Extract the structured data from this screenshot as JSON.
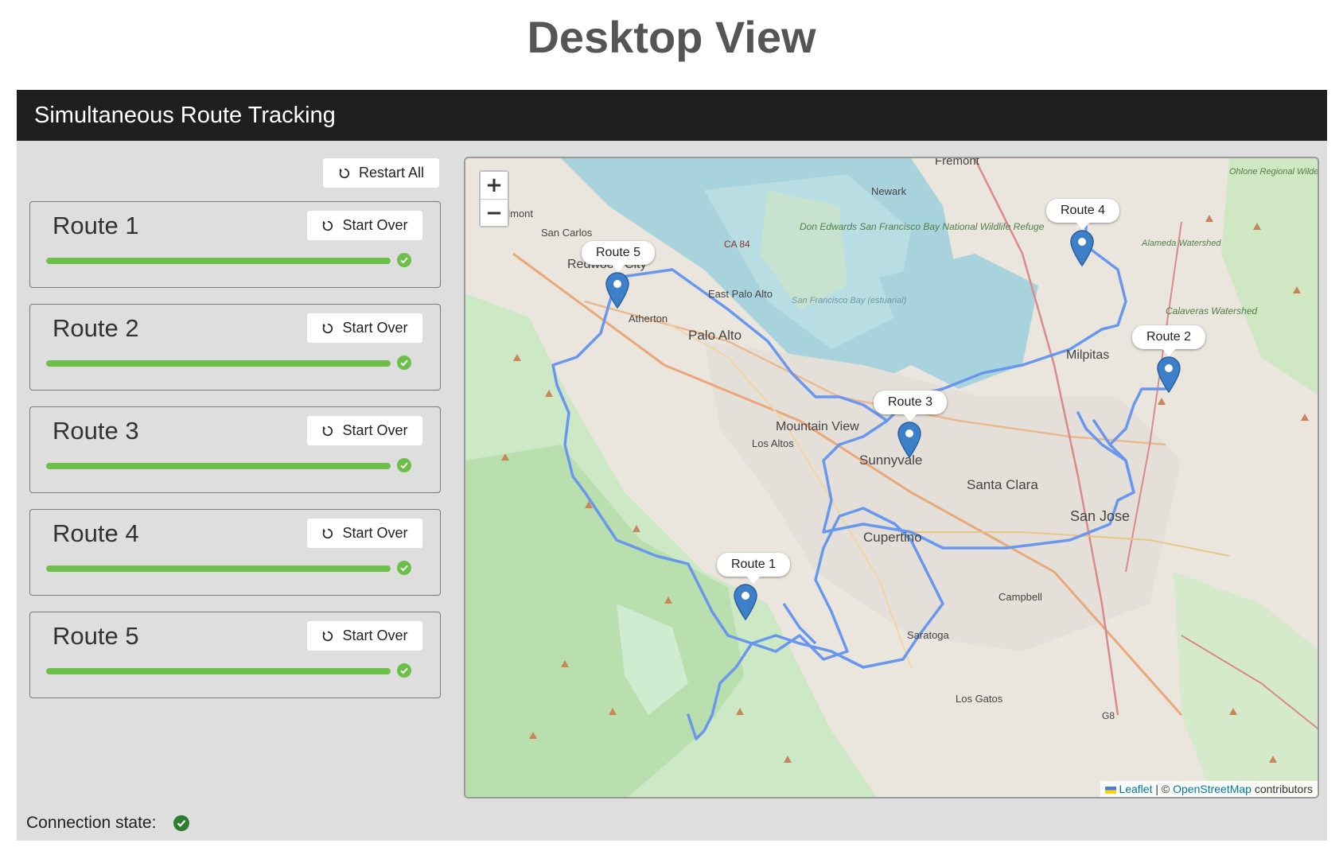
{
  "page": {
    "title": "Desktop View"
  },
  "app": {
    "title": "Simultaneous Route Tracking"
  },
  "controls": {
    "restart_all_label": "Restart All",
    "restart_icon": "restart-icon"
  },
  "routes": [
    {
      "name": "Route 1",
      "button_label": "Start Over",
      "progress": 1.0,
      "status": "complete"
    },
    {
      "name": "Route 2",
      "button_label": "Start Over",
      "progress": 1.0,
      "status": "complete"
    },
    {
      "name": "Route 3",
      "button_label": "Start Over",
      "progress": 1.0,
      "status": "complete"
    },
    {
      "name": "Route 4",
      "button_label": "Start Over",
      "progress": 1.0,
      "status": "complete"
    },
    {
      "name": "Route 5",
      "button_label": "Start Over",
      "progress": 1.0,
      "status": "complete"
    }
  ],
  "map": {
    "zoom_in": "+",
    "zoom_out": "−",
    "attribution": {
      "leaflet": "Leaflet",
      "separator": " | © ",
      "osm": "OpenStreetMap",
      "suffix": " contributors"
    },
    "markers": [
      "Route 1",
      "Route 2",
      "Route 3",
      "Route 4",
      "Route 5"
    ],
    "place_labels": {
      "fremont": "Fremont",
      "newark": "Newark",
      "belmont": "elmont",
      "san_carlos": "San Carlos",
      "redwood_city": "Redwood City",
      "east_palo_alto": "East Palo Alto",
      "atherton": "Atherton",
      "palo_alto": "Palo Alto",
      "mountain_view": "Mountain View",
      "los_altos": "Los Altos",
      "sunnyvale": "Sunnyvale",
      "santa_clara": "Santa Clara",
      "san_jose": "San Jose",
      "cupertino": "Cupertino",
      "milpitas": "Milpitas",
      "campbell": "Campbell",
      "saratoga": "Saratoga",
      "los_gatos": "Los Gatos",
      "don_edwards": "Don Edwards San Francisco Bay National Wildlife Refuge",
      "sf_bay": "San Francisco Bay (estuarial)",
      "ohlone": "Ohlone Regional Wilderness Preserve",
      "alameda": "Alameda Watershed",
      "calaveras": "Calaveras Watershed",
      "ca84": "CA 84",
      "g8": "G8"
    },
    "route_color": "#6a97ee",
    "marker_color": "#3d7fc9"
  },
  "connection": {
    "label": "Connection state:",
    "status": "connected"
  },
  "colors": {
    "header_bg": "#1f1f1f",
    "progress": "#6cc04a",
    "connection_ok": "#2f7d32"
  }
}
